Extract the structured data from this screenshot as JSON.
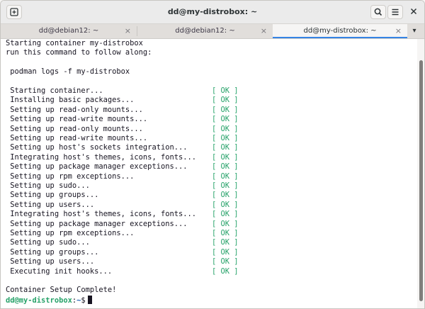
{
  "window": {
    "title": "dd@my-distrobox: ~"
  },
  "header": {
    "new_tab_icon": "new-tab-icon",
    "search_icon": "search-icon",
    "menu_icon": "hamburger-menu-icon"
  },
  "tabs": [
    {
      "label": "dd@debian12: ~",
      "active": false
    },
    {
      "label": "dd@debian12: ~",
      "active": false
    },
    {
      "label": "dd@my-distrobox: ~",
      "active": true
    }
  ],
  "tab_close_glyph": "×",
  "tabs_menu_glyph": "▾",
  "terminal": {
    "intro": [
      "Starting container my-distrobox",
      "run this command to follow along:",
      "",
      " podman logs -f my-distrobox",
      ""
    ],
    "status_lines": [
      " Starting container...",
      " Installing basic packages...",
      " Setting up read-only mounts...",
      " Setting up read-write mounts...",
      " Setting up read-only mounts...",
      " Setting up read-write mounts...",
      " Setting up host's sockets integration...",
      " Integrating host's themes, icons, fonts...",
      " Setting up package manager exceptions...",
      " Setting up rpm exceptions...",
      " Setting up sudo...",
      " Setting up groups...",
      " Setting up users...",
      " Integrating host's themes, icons, fonts...",
      " Setting up package manager exceptions...",
      " Setting up rpm exceptions...",
      " Setting up sudo...",
      " Setting up groups...",
      " Setting up users...",
      " Executing init hooks..."
    ],
    "ok_label": "[ OK ]",
    "complete": "Container Setup Complete!",
    "prompt_user": "dd@my-distrobox",
    "prompt_sep": ":",
    "prompt_path": "~",
    "prompt_symbol": "$"
  },
  "colors": {
    "ok_green": "#26a269",
    "path_blue": "#1a5fb4",
    "active_tab_accent": "#3584e4"
  }
}
